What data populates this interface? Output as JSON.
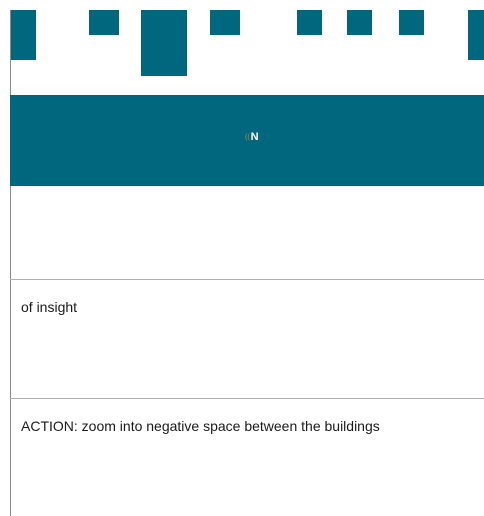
{
  "colors": {
    "accent": "#00677f",
    "logo_mark": "#c58a3a",
    "divider": "#b0b0b0"
  },
  "banner": {
    "logo_mark": "((",
    "logo_letter": "N"
  },
  "panels": [
    {
      "text": "of insight"
    },
    {
      "text": "ACTION: zoom into negative space between the buildings"
    }
  ]
}
